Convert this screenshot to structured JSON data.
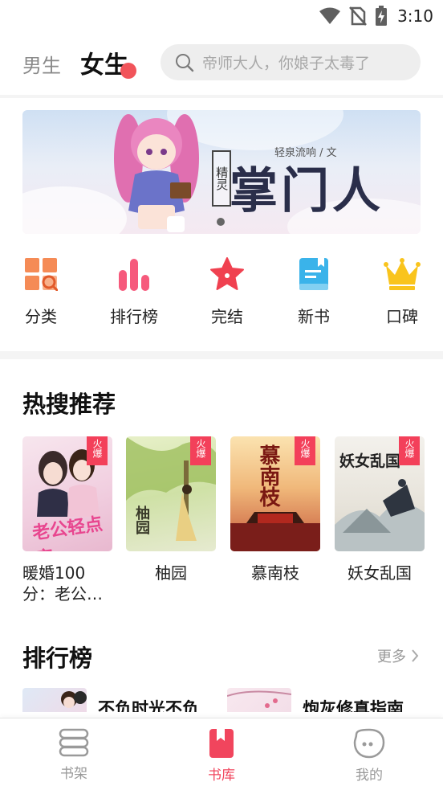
{
  "status_bar": {
    "time": "3:10"
  },
  "header": {
    "tab_male": "男生",
    "tab_female": "女生",
    "search_placeholder": "帝师大人，你娘子太毒了"
  },
  "banner": {
    "tag": "精灵",
    "title": "掌门人",
    "author": "轻泉流响 / 文"
  },
  "quick_nav": [
    {
      "label": "分类",
      "icon": "category-grid-icon"
    },
    {
      "label": "排行榜",
      "icon": "ranking-bars-icon"
    },
    {
      "label": "完结",
      "icon": "star-icon"
    },
    {
      "label": "新书",
      "icon": "new-book-icon"
    },
    {
      "label": "口碑",
      "icon": "crown-icon"
    }
  ],
  "hot_search": {
    "title": "热搜推荐",
    "badge": "火爆",
    "books": [
      {
        "name": "暖婚100分：老公…",
        "cover_text": "老公轻点宠"
      },
      {
        "name": "柚园",
        "cover_text": "柚园"
      },
      {
        "name": "慕南枝",
        "cover_text": "慕南枝"
      },
      {
        "name": "妖女乱国",
        "cover_text": "妖女乱国"
      }
    ]
  },
  "ranking": {
    "title": "排行榜",
    "more": "更多",
    "items": [
      {
        "title": "不负时光不负"
      },
      {
        "title": "炮灰修真指南"
      }
    ]
  },
  "bottom_nav": [
    {
      "label": "书架",
      "icon": "bookshelf-icon"
    },
    {
      "label": "书库",
      "icon": "library-icon",
      "active": true
    },
    {
      "label": "我的",
      "icon": "profile-icon"
    }
  ],
  "colors": {
    "accent": "#f1455d",
    "badge": "#f3405a",
    "dot": "#f1545a"
  }
}
